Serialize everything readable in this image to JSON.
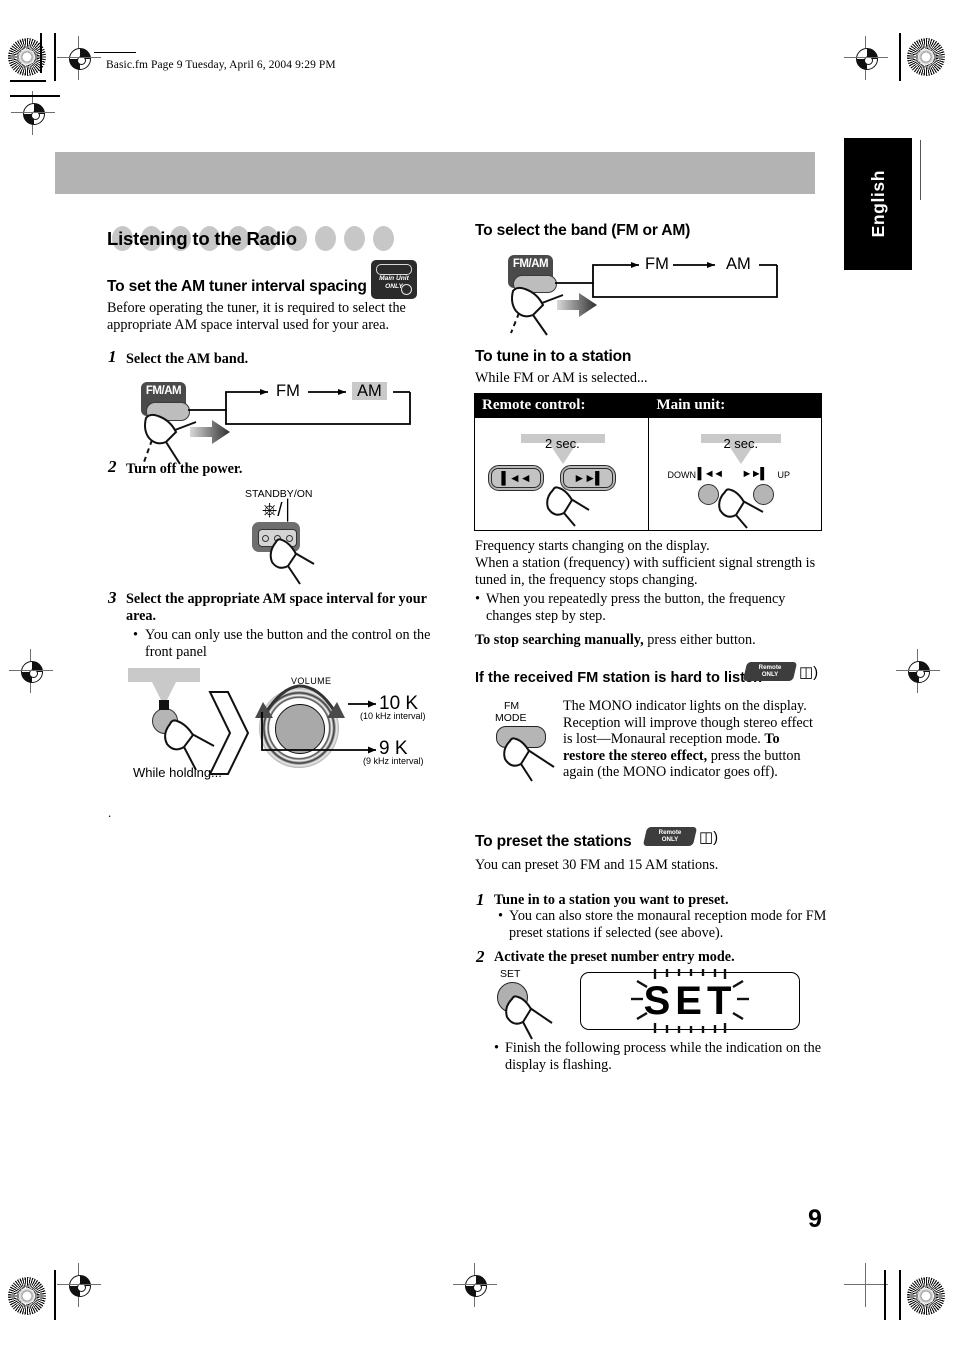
{
  "page": {
    "file_header": "Basic.fm  Page 9  Tuesday, April 6, 2004  9:29 PM",
    "language_tab": "English",
    "page_number": "9"
  },
  "left_column": {
    "section_title": "Listening to the Radio",
    "heading_am_spacing": "To set the AM tuner interval spacing",
    "main_unit_badge": {
      "line1": "Main Unit",
      "line2": "ONLY"
    },
    "intro": "Before operating the tuner, it is required to select the appropriate AM space interval used for your area.",
    "steps": [
      {
        "num": "1",
        "text": "Select the AM band.",
        "diagram": {
          "button_label": "FM/AM",
          "from": "FM",
          "to": "AM",
          "highlight": "AM"
        }
      },
      {
        "num": "2",
        "text": "Turn off the power.",
        "diagram": {
          "button_label": "STANDBY/ON",
          "symbol": "power-symbol"
        }
      },
      {
        "num": "3",
        "text": "Select the appropriate AM space interval for your area.",
        "bullet": "You can only use the button and the control on the front panel",
        "diagram": {
          "hold_label": "While holding...",
          "knob_label": "VOLUME",
          "option_a": "10 K",
          "option_a_note": "(10 kHz interval)",
          "option_b": "9 K",
          "option_b_note": "(9 kHz interval)"
        }
      }
    ]
  },
  "right_column": {
    "heading_band": "To select the band (FM or AM)",
    "band_diagram": {
      "button_label": "FM/AM",
      "from": "FM",
      "to": "AM"
    },
    "heading_tune": "To tune in to a station",
    "tune_intro": "While FM or AM is selected...",
    "tune_table": {
      "headers": [
        "Remote control:",
        "Main unit:"
      ],
      "remote": {
        "hold_time": "2 sec.",
        "button_left": "skip-back-icon",
        "button_right": "skip-forward-icon"
      },
      "main_unit": {
        "hold_time": "2 sec.",
        "label_down": "DOWN",
        "label_up": "UP"
      }
    },
    "tune_body_1": "Frequency starts changing on the display.",
    "tune_body_2": "When a station (frequency) with sufficient signal strength is tuned in, the frequency stops changing.",
    "tune_bullet": "When you repeatedly press the button, the frequency changes step by step.",
    "tune_stop_bold": "To stop searching manually,",
    "tune_stop_rest": " press either button.",
    "heading_fm_mode": "If the received FM station is hard to listen",
    "remote_only_badge": {
      "line1": "Remote",
      "line2": "ONLY"
    },
    "fm_mode_button": {
      "line1": "FM",
      "line2": "MODE"
    },
    "fm_mode_text_1": "The MONO indicator lights on the display. Reception will improve though stereo effect is lost—Monaural reception mode.",
    "fm_mode_bold": "To restore the stereo effect,",
    "fm_mode_text_2": " press the button again (the MONO indicator goes off).",
    "heading_preset": "To preset the stations",
    "preset_intro": "You can preset 30 FM and 15 AM stations.",
    "preset_steps": [
      {
        "num": "1",
        "text": "Tune in to a station you want to preset.",
        "bullet": "You can also store the monaural reception mode for FM preset stations if selected (see above)."
      },
      {
        "num": "2",
        "text": "Activate the preset number entry mode.",
        "button_label": "SET",
        "display_text": "SET",
        "bullet": "Finish the following process while the indication on the display is flashing."
      }
    ]
  },
  "colors": {
    "gray_bar": "#b3b3b3",
    "dot_gray": "#c7c7c7",
    "button_dark": "#4a4a4a",
    "keycap_gray": "#b9b9b9",
    "highlight_gray": "#c9c9c9"
  }
}
